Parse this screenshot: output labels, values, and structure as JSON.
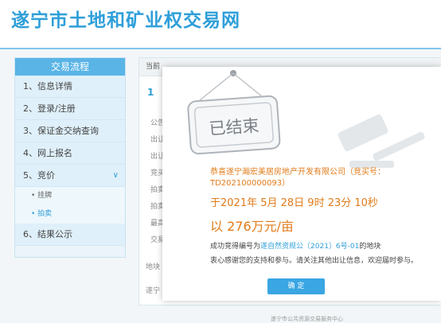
{
  "site": {
    "title": "遂宁市土地和矿业权交易网"
  },
  "sidebar": {
    "header": "交易流程",
    "items": [
      {
        "label": "1、信息详情"
      },
      {
        "label": "2、登录/注册"
      },
      {
        "label": "3、保证金交纳查询"
      },
      {
        "label": "4、网上报名"
      },
      {
        "label": "5、竞价"
      },
      {
        "label": "6、结果公示"
      }
    ],
    "subitems": [
      {
        "label": "• 挂牌"
      },
      {
        "label": "• 拍卖"
      }
    ]
  },
  "content": {
    "breadcrumb": "当前",
    "step": "1",
    "row_labels": [
      "公告",
      "出让",
      "出让",
      "竞买",
      "拍卖",
      "拍卖",
      "最高",
      "交易"
    ],
    "block_label": "地块",
    "bottom_label": "遂宁"
  },
  "modal": {
    "stamp_text": "已结束",
    "winner_line1": "恭喜遂宁瀚宏美居房地产开发有限公司（竞买号：",
    "winner_line2": "TD202100000093）",
    "time": "于2021年 5月 28日 9时 23分 10秒",
    "price": "以 276万元/亩",
    "result_prefix": "成功竞得编号为",
    "result_link": "遂自然资规公〔2021〕6号-01",
    "result_suffix": "的地块",
    "thanks": "衷心感谢您的支持和参与。请关注其他出让信息，欢迎届时参与。",
    "confirm": "确 定"
  },
  "footer": {
    "text": "遂宁市公共资源交易服务中心"
  }
}
